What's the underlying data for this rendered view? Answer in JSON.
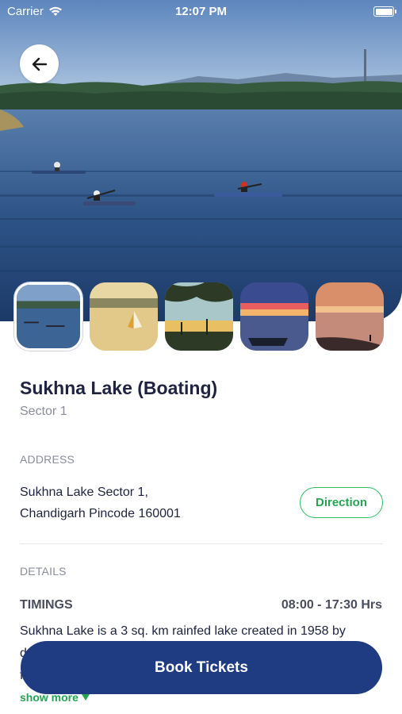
{
  "status_bar": {
    "carrier": "Carrier",
    "time": "12:07 PM",
    "battery_level": 1.0
  },
  "header": {
    "back_icon": "arrow-left-icon"
  },
  "gallery": {
    "selected_index": 0,
    "thumbnails": [
      {
        "name": "lake-kayaks"
      },
      {
        "name": "sailboat"
      },
      {
        "name": "palm-sunset"
      },
      {
        "name": "twilight-boat"
      },
      {
        "name": "shore-sunset"
      }
    ]
  },
  "place": {
    "title": "Sukhna Lake (Boating)",
    "subtitle": "Sector 1"
  },
  "address": {
    "label": "ADDRESS",
    "line1": "Sukhna Lake Sector 1,",
    "line2": "Chandigarh Pincode 160001",
    "direction_label": "Direction"
  },
  "details": {
    "label": "DETAILS",
    "timings_label": "TIMINGS",
    "timings_value": "08:00 - 17:30 Hrs",
    "description": "Sukhna Lake is a 3 sq. km rainfed lake created in 1958 by damming the Sukhna Choe, a seasonal stream coming down from the Shivalik Hills.",
    "show_more_label": "show more"
  },
  "actions": {
    "book_label": "Book Tickets"
  },
  "colors": {
    "primary": "#1f3c83",
    "accent_green": "#25a552",
    "muted": "#8a8d9b"
  }
}
